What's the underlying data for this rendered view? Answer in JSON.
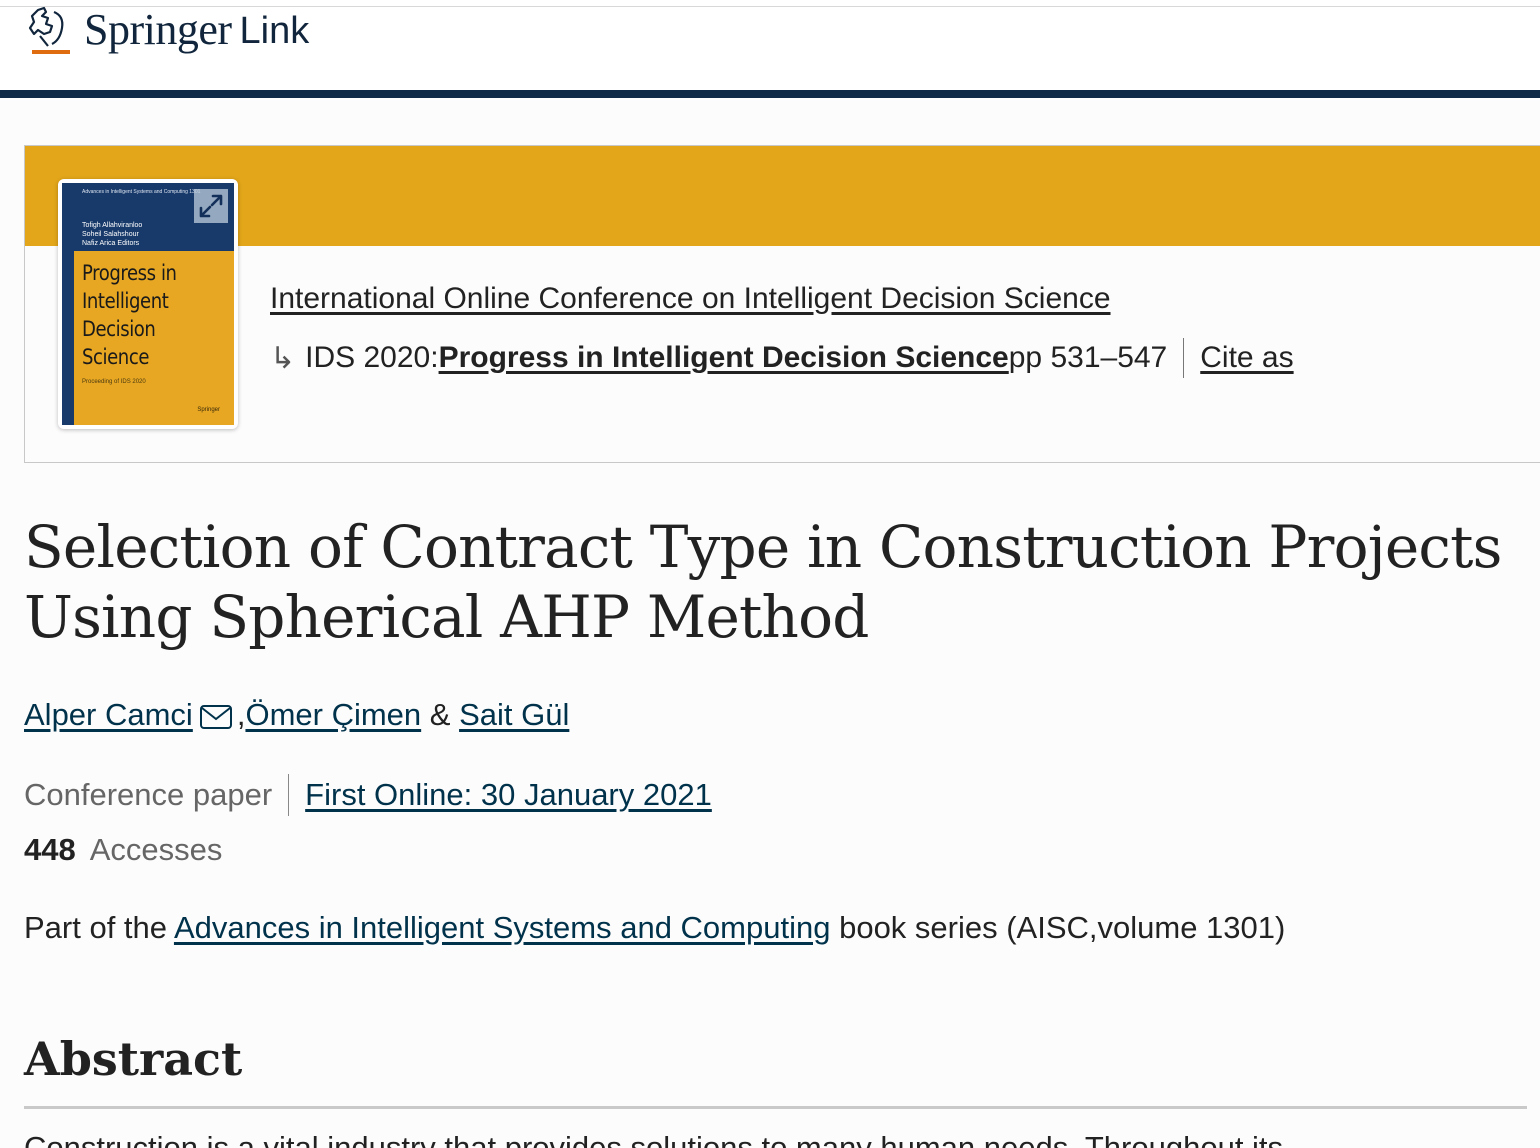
{
  "brand": {
    "name": "Springer",
    "product": "Link",
    "accent": "#e06c10",
    "navy": "#0f2a47"
  },
  "book": {
    "band_color": "#e3a61a",
    "cover": {
      "series": "Advances in Intelligent Systems and Computing 1301",
      "editors": [
        "Tofigh Allahviranloo",
        "Soheil Salahshour",
        "Nafiz Arica  Editors"
      ],
      "title_lines": [
        "Progress in",
        "Intelligent",
        "Decision",
        "Science"
      ],
      "proceedings": "Proceeding of IDS 2020",
      "publisher": "Springer"
    },
    "conference": "International Online Conference on Intelligent Decision Science",
    "ids_prefix": "IDS 2020: ",
    "book_title": "Progress in Intelligent Decision Science",
    "pages": " pp 531–547",
    "cite_label": "Cite as"
  },
  "article": {
    "title": "Selection of Contract Type in Construction Projects Using Spherical AHP Method",
    "authors": [
      {
        "name": "Alper Camci"
      },
      {
        "name": "Ömer Çimen"
      },
      {
        "name": "Sait Gül"
      }
    ],
    "separators": {
      "comma": ", ",
      "amp": " & "
    },
    "type": "Conference paper",
    "first_online": "First Online: 30 January 2021",
    "accesses_count": "448",
    "accesses_label": "Accesses",
    "series_prefix": "Part of the ",
    "series_link": "Advances in Intelligent Systems and Computing",
    "series_suffix": " book series (AISC,volume 1301)"
  },
  "abstract": {
    "heading": "Abstract",
    "text": "Construction is a vital industry that provides solutions to many human needs. Throughout its"
  }
}
